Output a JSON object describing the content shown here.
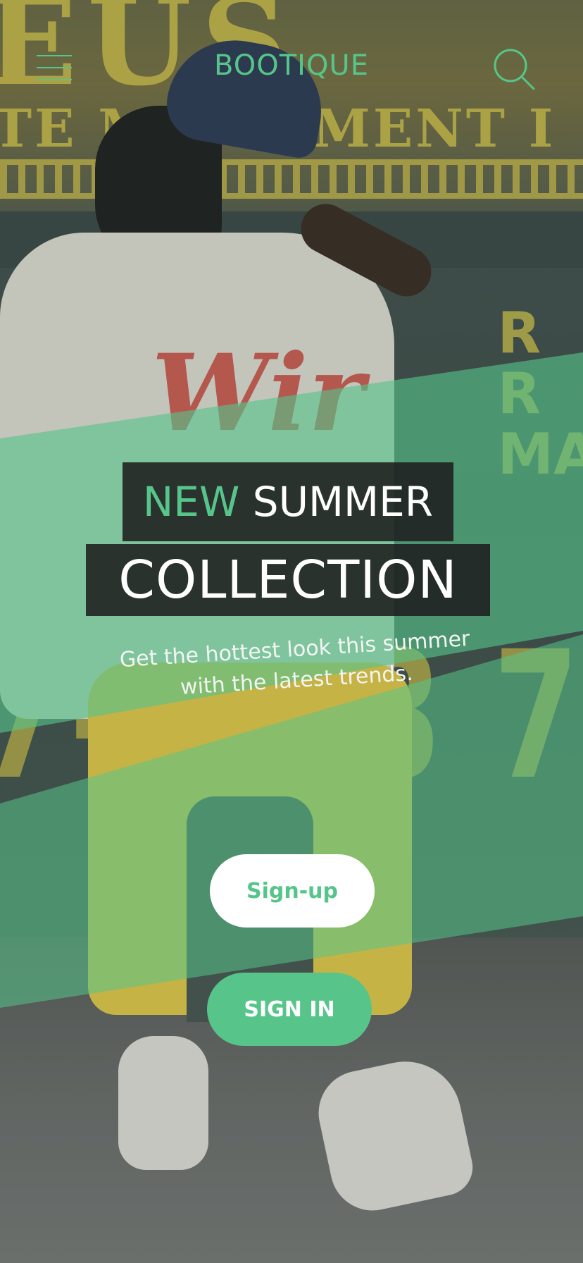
{
  "header": {
    "brand": "BOOTIQUE",
    "menu_icon": "hamburger-menu-icon",
    "search_icon": "search-icon"
  },
  "hero": {
    "title_accent": "NEW",
    "title_rest": "SUMMER",
    "title_line2": "COLLECTION",
    "subtitle_line1": "Get the hottest look this summer",
    "subtitle_line2": "with the latest trends."
  },
  "actions": {
    "signup_label": "Sign-up",
    "signin_label": "SIGN IN"
  },
  "colors": {
    "accent": "#57c58a",
    "title_box": "#1e1e1e",
    "button_light": "#ffffff"
  }
}
